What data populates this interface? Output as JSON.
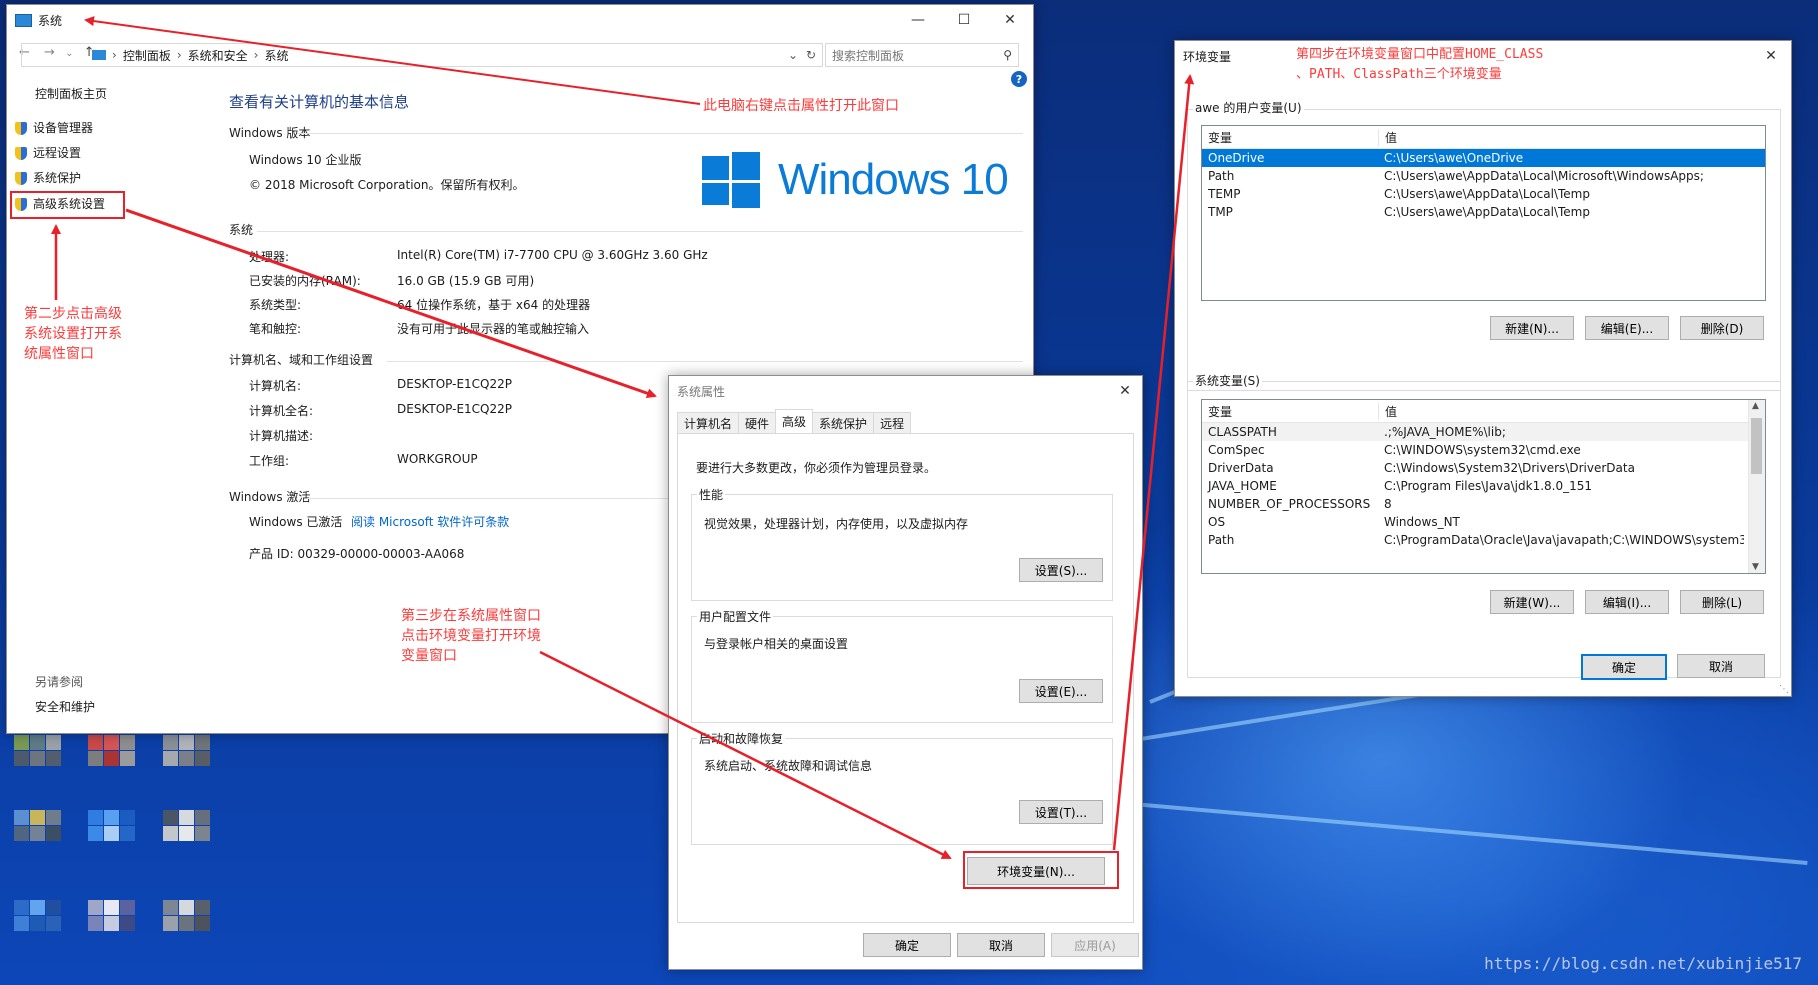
{
  "system_window": {
    "title": "系统",
    "breadcrumb": [
      "控制面板",
      "系统和安全",
      "系统"
    ],
    "search_placeholder": "搜索控制面板",
    "sidebar": {
      "home": "控制面板主页",
      "items": [
        "设备管理器",
        "远程设置",
        "系统保护",
        "高级系统设置"
      ],
      "see_also": "另请参阅",
      "security": "安全和维护"
    },
    "heading": "查看有关计算机的基本信息",
    "edition_section": "Windows 版本",
    "edition": "Windows 10 企业版",
    "copyright": "© 2018 Microsoft Corporation。保留所有权利。",
    "logo_text": "Windows 10",
    "system_section": "系统",
    "system_rows": [
      {
        "label": "处理器:",
        "value": "Intel(R) Core(TM) i7-7700 CPU @ 3.60GHz   3.60 GHz"
      },
      {
        "label": "已安装的内存(RAM):",
        "value": "16.0 GB (15.9 GB 可用)"
      },
      {
        "label": "系统类型:",
        "value": "64 位操作系统，基于 x64 的处理器"
      },
      {
        "label": "笔和触控:",
        "value": "没有可用于此显示器的笔或触控输入"
      }
    ],
    "computer_section": "计算机名、域和工作组设置",
    "computer_rows": [
      {
        "label": "计算机名:",
        "value": "DESKTOP-E1CQ22P"
      },
      {
        "label": "计算机全名:",
        "value": "DESKTOP-E1CQ22P"
      },
      {
        "label": "计算机描述:",
        "value": ""
      },
      {
        "label": "工作组:",
        "value": "WORKGROUP"
      }
    ],
    "activation_section": "Windows 激活",
    "activated": "Windows 已激活",
    "license_link": "阅读 Microsoft 软件许可条款",
    "product_id": "产品 ID: 00329-00000-00003-AA068"
  },
  "sysprop_dialog": {
    "title": "系统属性",
    "tabs": [
      "计算机名",
      "硬件",
      "高级",
      "系统保护",
      "远程"
    ],
    "active_tab": "高级",
    "admin_note": "要进行大多数更改，你必须作为管理员登录。",
    "perf_group": "性能",
    "perf_desc": "视觉效果，处理器计划，内存使用，以及虚拟内存",
    "perf_btn": "设置(S)...",
    "profile_group": "用户配置文件",
    "profile_desc": "与登录帐户相关的桌面设置",
    "profile_btn": "设置(E)...",
    "startup_group": "启动和故障恢复",
    "startup_desc": "系统启动、系统故障和调试信息",
    "startup_btn": "设置(T)...",
    "env_btn": "环境变量(N)...",
    "ok": "确定",
    "cancel": "取消",
    "apply": "应用(A)"
  },
  "env_dialog": {
    "title": "环境变量",
    "user_group": "awe 的用户变量(U)",
    "col_var": "变量",
    "col_val": "值",
    "user_vars": [
      {
        "name": "OneDrive",
        "value": "C:\\Users\\awe\\OneDrive"
      },
      {
        "name": "Path",
        "value": "C:\\Users\\awe\\AppData\\Local\\Microsoft\\WindowsApps;"
      },
      {
        "name": "TEMP",
        "value": "C:\\Users\\awe\\AppData\\Local\\Temp"
      },
      {
        "name": "TMP",
        "value": "C:\\Users\\awe\\AppData\\Local\\Temp"
      }
    ],
    "user_new": "新建(N)...",
    "user_edit": "编辑(E)...",
    "user_delete": "删除(D)",
    "sys_group": "系统变量(S)",
    "sys_vars": [
      {
        "name": "CLASSPATH",
        "value": ".;%JAVA_HOME%\\lib;"
      },
      {
        "name": "ComSpec",
        "value": "C:\\WINDOWS\\system32\\cmd.exe"
      },
      {
        "name": "DriverData",
        "value": "C:\\Windows\\System32\\Drivers\\DriverData"
      },
      {
        "name": "JAVA_HOME",
        "value": "C:\\Program Files\\Java\\jdk1.8.0_151"
      },
      {
        "name": "NUMBER_OF_PROCESSORS",
        "value": "8"
      },
      {
        "name": "OS",
        "value": "Windows_NT"
      },
      {
        "name": "Path",
        "value": "C:\\ProgramData\\Oracle\\Java\\javapath;C:\\WINDOWS\\system3..."
      }
    ],
    "sys_new": "新建(W)...",
    "sys_edit": "编辑(I)...",
    "sys_delete": "删除(L)",
    "ok": "确定",
    "cancel": "取消"
  },
  "annotations": {
    "step1": "此电脑右键点击属性打开此窗口",
    "step2": [
      "第二步点击高级",
      "系统设置打开系",
      "统属性窗口"
    ],
    "step3": [
      "第三步在系统属性窗口",
      "点击环境变量打开环境",
      "变量窗口"
    ],
    "step4": [
      "第四步在环境变量窗口中配置HOME_CLASS",
      "、PATH、ClassPath三个环境变量"
    ]
  },
  "watermark": "https://blog.csdn.net/xubinjie517",
  "colors": {
    "annotation_red": "#e8202a",
    "selection_blue": "#0078d7",
    "link_blue": "#0066cc"
  }
}
